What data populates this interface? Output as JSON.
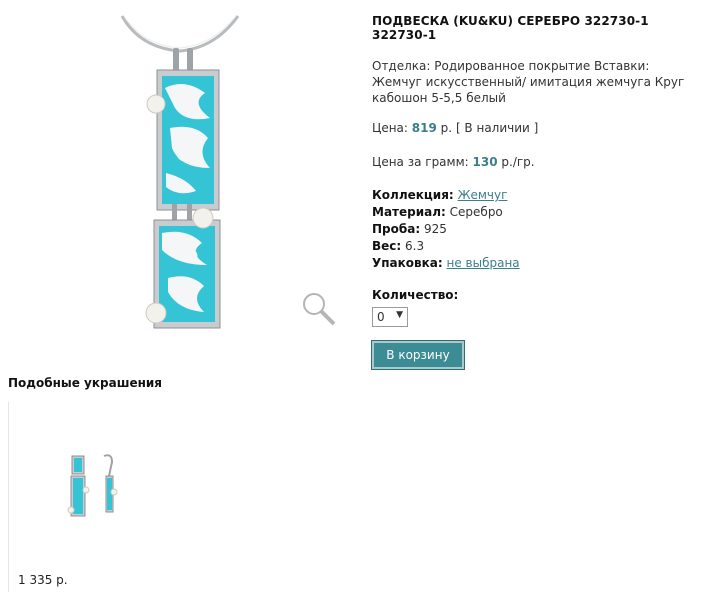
{
  "product": {
    "title": "ПОДВЕСКА (KU&KU) СЕРЕБРО 322730-1 322730-1",
    "description": "Отделка: Родированное покрытие Вставки: Жемчуг искусственный/ имитация жемчуга Круг кабошон 5-5,5 белый",
    "price_label": "Цена:",
    "price_value": "819",
    "price_unit": "р.",
    "availability": "[ В наличии ]",
    "gram_label": "Цена за грамм:",
    "gram_value": "130",
    "gram_unit": "р./гр.",
    "collection_label": "Коллекция:",
    "collection_value": "Жемчуг",
    "material_label": "Материал:",
    "material_value": "Серебро",
    "probe_label": "Проба:",
    "probe_value": "925",
    "weight_label": "Вес:",
    "weight_value": "6.3",
    "package_label": "Упаковка:",
    "package_value": "не выбрана",
    "qty_label": "Количество:",
    "qty_value": "0",
    "cart_button": "В корзину"
  },
  "similar": {
    "title": "Подобные украшения",
    "items": [
      {
        "price": "1 335 р."
      }
    ]
  },
  "colors": {
    "accent": "#3a7f8b",
    "enamel": "#35c3d6",
    "silver": "#c9ccce"
  }
}
